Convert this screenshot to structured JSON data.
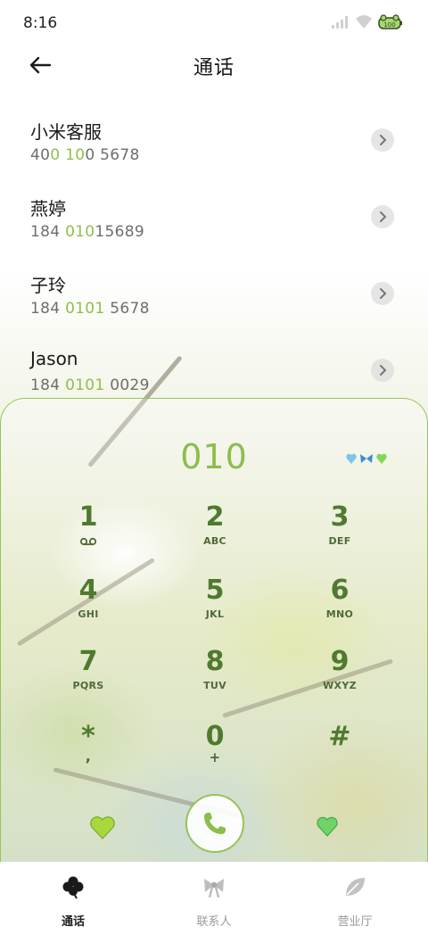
{
  "status_bar": {
    "time": "8:16"
  },
  "header": {
    "title": "通话"
  },
  "contacts": [
    {
      "name": "小米客服",
      "number_parts": [
        "40",
        "0",
        " ",
        "10",
        "0 5678"
      ]
    },
    {
      "name": "燕婷",
      "number_parts": [
        "184 ",
        "010",
        "15689",
        "",
        ""
      ]
    },
    {
      "name": "子玲",
      "number_parts": [
        "184 ",
        "0101",
        " 5678",
        "",
        ""
      ]
    },
    {
      "name": "Jason",
      "number_parts": [
        "184 ",
        "0101",
        " 0029",
        "",
        ""
      ]
    }
  ],
  "dialpad": {
    "display": "010",
    "keys": [
      {
        "digit": "1",
        "letters": ""
      },
      {
        "digit": "2",
        "letters": "ABC"
      },
      {
        "digit": "3",
        "letters": "DEF"
      },
      {
        "digit": "4",
        "letters": "GHI"
      },
      {
        "digit": "5",
        "letters": "JKL"
      },
      {
        "digit": "6",
        "letters": "MNO"
      },
      {
        "digit": "7",
        "letters": "PQRS"
      },
      {
        "digit": "8",
        "letters": "TUV"
      },
      {
        "digit": "9",
        "letters": "WXYZ"
      },
      {
        "digit": "*",
        "letters": ","
      },
      {
        "digit": "0",
        "letters": "+"
      },
      {
        "digit": "#",
        "letters": ""
      }
    ]
  },
  "bottom_nav": [
    {
      "label": "通话",
      "icon": "clover-icon",
      "active": true
    },
    {
      "label": "联系人",
      "icon": "bow-icon",
      "active": false
    },
    {
      "label": "营业厅",
      "icon": "leaf-icon",
      "active": false
    }
  ],
  "colors": {
    "accent": "#8cbd4d",
    "key_text": "#4f7a2f",
    "border": "#97c458"
  }
}
